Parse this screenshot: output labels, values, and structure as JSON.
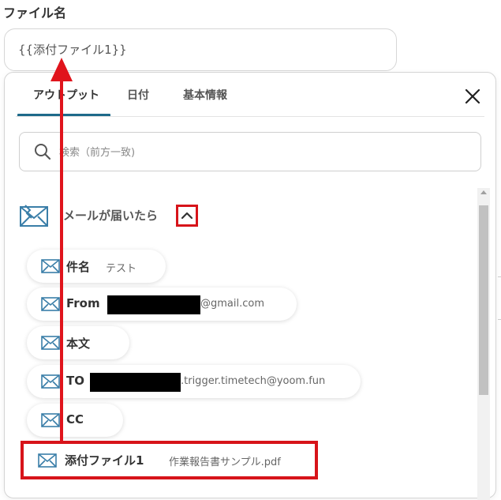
{
  "field": {
    "label": "ファイル名",
    "value": "{{添付ファイル1}}"
  },
  "tabs": [
    {
      "label": "アウトプット",
      "active": true
    },
    {
      "label": "日付",
      "active": false
    },
    {
      "label": "基本情報",
      "active": false
    }
  ],
  "search": {
    "placeholder": "検索（前方一致)"
  },
  "section": {
    "title": "メールが届いたら",
    "icon": "mail-icon",
    "expanded": true
  },
  "items": [
    {
      "label": "件名",
      "value": "テスト"
    },
    {
      "label": "From",
      "value": "@gmail.com"
    },
    {
      "label": "本文",
      "value": ""
    },
    {
      "label": "TO",
      "value": ".trigger.timetech@yoom.fun"
    },
    {
      "label": "CC",
      "value": ""
    },
    {
      "label": "添付ファイル1",
      "value": "作業報告書サンプル.pdf"
    }
  ],
  "colors": {
    "accent": "#1e6a8a",
    "highlight": "#d7141a",
    "icon": "#3a7ea8"
  }
}
